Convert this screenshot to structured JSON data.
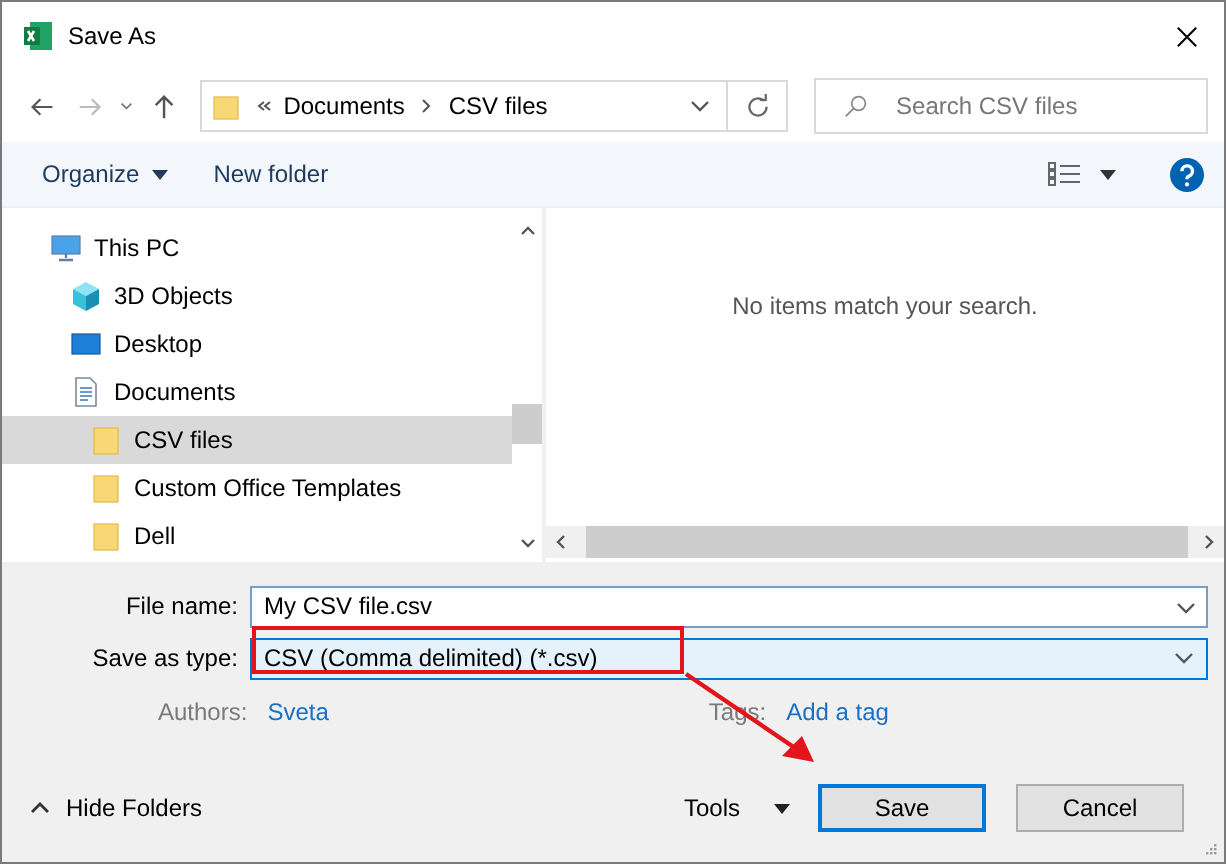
{
  "window": {
    "title": "Save As"
  },
  "address_bar": {
    "path": [
      "Documents",
      "CSV files"
    ]
  },
  "search": {
    "placeholder": "Search CSV files"
  },
  "toolbar": {
    "organize": "Organize",
    "new_folder": "New folder"
  },
  "tree": [
    {
      "label": "This PC",
      "kind": "pc",
      "selected": false,
      "children": [
        {
          "label": "3D Objects",
          "kind": "cube",
          "selected": false
        },
        {
          "label": "Desktop",
          "kind": "desktop",
          "selected": false
        },
        {
          "label": "Documents",
          "kind": "document",
          "selected": false,
          "children": [
            {
              "label": "CSV files",
              "kind": "folder",
              "selected": true
            },
            {
              "label": "Custom Office Templates",
              "kind": "folder",
              "selected": false
            },
            {
              "label": "Dell",
              "kind": "folder",
              "selected": false
            }
          ]
        }
      ]
    }
  ],
  "content": {
    "empty_message": "No items match your search."
  },
  "form": {
    "file_name_label": "File name:",
    "file_name": "My CSV file.csv",
    "type_label": "Save as type:",
    "type": "CSV (Comma delimited) (*.csv)",
    "authors_label": "Authors:",
    "authors": "Sveta",
    "tags_label": "Tags:",
    "tags_placeholder": "Add a tag"
  },
  "footer": {
    "hide_folders": "Hide Folders",
    "tools": "Tools",
    "buttons": [
      {
        "label": "Save",
        "default": true
      },
      {
        "label": "Cancel",
        "default": false
      }
    ]
  }
}
